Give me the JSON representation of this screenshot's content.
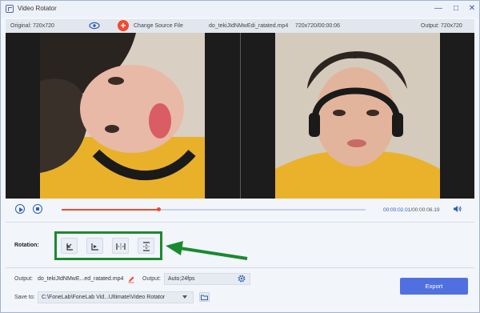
{
  "window": {
    "title": "Video Rotator"
  },
  "infobar": {
    "original": "Original: 720x720",
    "change_source": "Change Source File",
    "file_name": "do_tekiJIdNMwEdi_ratated.mp4",
    "file_meta": "720x720/00:00:06",
    "output": "Output: 720x720"
  },
  "playback": {
    "current_time": "00:00:02.01",
    "total_time": "/00:00:06.19",
    "progress": 0.32
  },
  "rotation": {
    "label": "Rotation:",
    "buttons": [
      "rotate-left-icon",
      "rotate-right-icon",
      "flip-horizontal-icon",
      "flip-vertical-icon"
    ]
  },
  "output": {
    "label": "Output:",
    "file": "do_tekiJIdNMwE...ed_ratated.mp4",
    "format_label": "Output:",
    "format_value": "Auto;24fps"
  },
  "save": {
    "label": "Save to:",
    "path": "C:\\FoneLab\\FoneLab Vid...Ultimate\\Video Rotator"
  },
  "export_label": "Export",
  "colors": {
    "accent": "#2d5fb3",
    "brand_red": "#f04a2f",
    "export": "#5070e0",
    "highlight": "#1a8a2f"
  }
}
